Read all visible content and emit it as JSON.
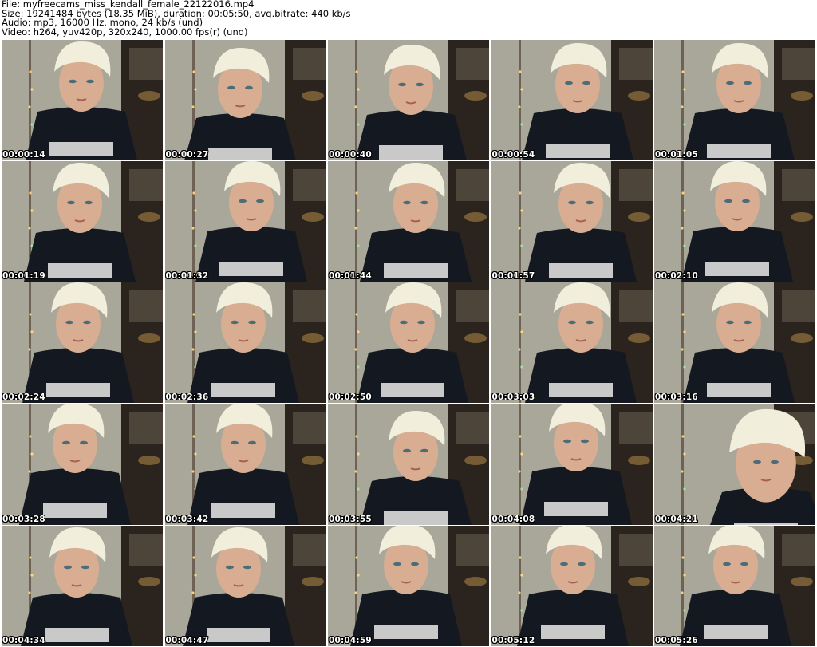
{
  "header": {
    "file_line": "File: myfreecams_miss_kendall_female_22122016.mp4",
    "size_line": "Size: 19241484 bytes (18.35 MiB), duration: 00:05:50, avg.bitrate: 440 kb/s",
    "audio_line": "Audio: mp3, 16000 Hz, mono, 24 kb/s (und)",
    "video_line": "Video: h264, yuv420p, 320x240, 1000.00 fps(r) (und)"
  },
  "thumbnails": [
    {
      "time": "00:00:14"
    },
    {
      "time": "00:00:27"
    },
    {
      "time": "00:00:40"
    },
    {
      "time": "00:00:54"
    },
    {
      "time": "00:01:05"
    },
    {
      "time": "00:01:19"
    },
    {
      "time": "00:01:32"
    },
    {
      "time": "00:01:44"
    },
    {
      "time": "00:01:57"
    },
    {
      "time": "00:02:10"
    },
    {
      "time": "00:02:24"
    },
    {
      "time": "00:02:36"
    },
    {
      "time": "00:02:50"
    },
    {
      "time": "00:03:03"
    },
    {
      "time": "00:03:16"
    },
    {
      "time": "00:03:28"
    },
    {
      "time": "00:03:42"
    },
    {
      "time": "00:03:55"
    },
    {
      "time": "00:04:08"
    },
    {
      "time": "00:04:21"
    },
    {
      "time": "00:04:34"
    },
    {
      "time": "00:04:47"
    },
    {
      "time": "00:04:59"
    },
    {
      "time": "00:05:12"
    },
    {
      "time": "00:05:26"
    }
  ],
  "colors": {
    "wall": "#a9a79a",
    "wall_shadow": "#5c5247",
    "hair": "#f1eedc",
    "skin": "#d8ad92",
    "shirt": "#141820",
    "shirt_print": "#e9e9e9",
    "background_dark": "#2b231d"
  }
}
